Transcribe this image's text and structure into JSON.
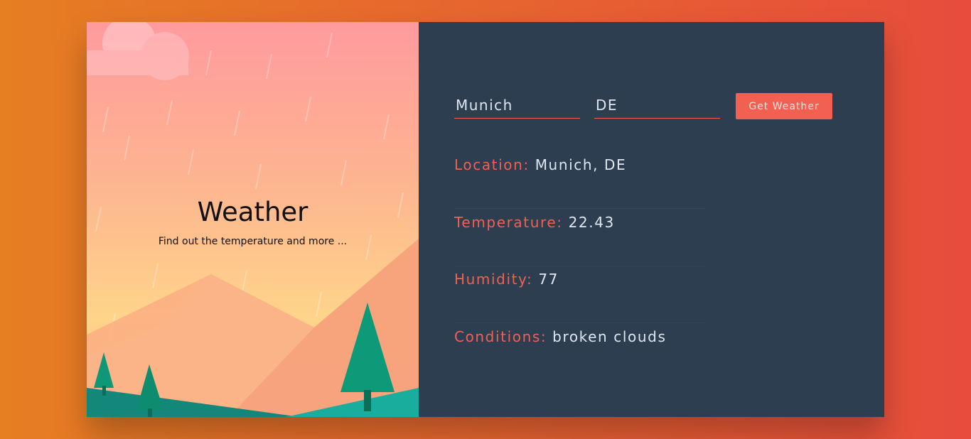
{
  "hero": {
    "title": "Weather",
    "subtitle": "Find out the temperature and more ..."
  },
  "form": {
    "city_value": "Munich",
    "country_value": "DE",
    "submit_label": "Get Weather"
  },
  "results": [
    {
      "label": "Location:",
      "value": "Munich, DE"
    },
    {
      "label": "Temperature:",
      "value": "22.43"
    },
    {
      "label": "Humidity:",
      "value": "77"
    },
    {
      "label": "Conditions:",
      "value": "broken clouds"
    }
  ],
  "colors": {
    "accent": "#f16051",
    "panel": "#2c3e50",
    "text_light": "#dfe6ee"
  }
}
